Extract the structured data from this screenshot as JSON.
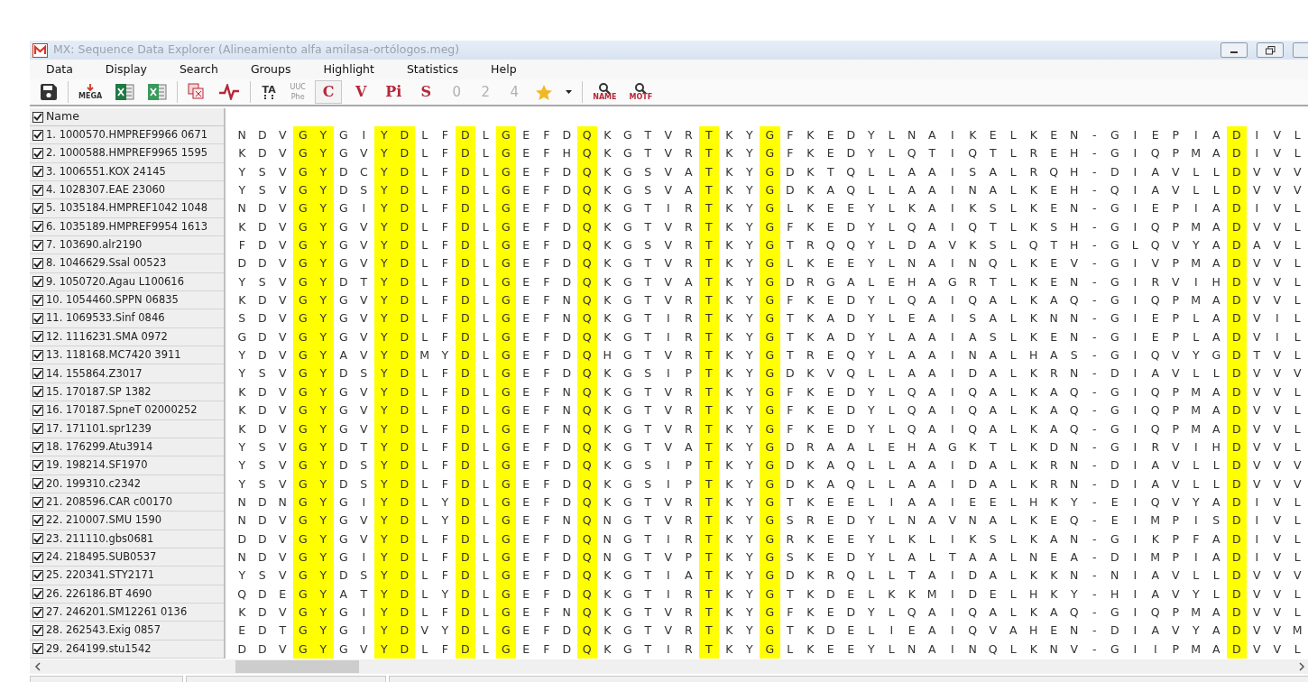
{
  "window": {
    "title": "MX: Sequence Data Explorer (Alineamiento alfa amilasa-ortólogos.meg)"
  },
  "menu": [
    "Data",
    "Display",
    "Search",
    "Groups",
    "Highlight",
    "Statistics",
    "Help"
  ],
  "toolbar": [
    {
      "kind": "save"
    },
    {
      "kind": "sep"
    },
    {
      "kind": "export",
      "label": "MEGA"
    },
    {
      "kind": "excel"
    },
    {
      "kind": "excel-alt"
    },
    {
      "kind": "sep"
    },
    {
      "kind": "copy"
    },
    {
      "kind": "plot"
    },
    {
      "kind": "sep"
    },
    {
      "kind": "translate",
      "label": "TA"
    },
    {
      "kind": "codon",
      "label": "UUC",
      "label2": "Phe",
      "disabled": true
    },
    {
      "kind": "toggle",
      "label": "C",
      "selected": true
    },
    {
      "kind": "toggle",
      "label": "V",
      "selected": false
    },
    {
      "kind": "toggle",
      "label": "Pi",
      "selected": false
    },
    {
      "kind": "toggle",
      "label": "S",
      "selected": false
    },
    {
      "kind": "digit",
      "label": "0",
      "disabled": true
    },
    {
      "kind": "digit",
      "label": "2",
      "disabled": true
    },
    {
      "kind": "digit",
      "label": "4",
      "disabled": true
    },
    {
      "kind": "star"
    },
    {
      "kind": "caret"
    },
    {
      "kind": "sep"
    },
    {
      "kind": "find",
      "label": "NAME"
    },
    {
      "kind": "find",
      "label": "MOTF"
    }
  ],
  "name_header": {
    "label": "Name",
    "checked": true
  },
  "columns": [
    {
      "highlighted": false
    },
    {
      "highlighted": false
    },
    {
      "highlighted": false
    },
    {
      "highlighted": true
    },
    {
      "highlighted": true
    },
    {
      "highlighted": false
    },
    {
      "highlighted": false
    },
    {
      "highlighted": true
    },
    {
      "highlighted": true
    },
    {
      "highlighted": false
    },
    {
      "highlighted": false
    },
    {
      "highlighted": true
    },
    {
      "highlighted": false
    },
    {
      "highlighted": true
    },
    {
      "highlighted": false
    },
    {
      "highlighted": false
    },
    {
      "highlighted": false
    },
    {
      "highlighted": true
    },
    {
      "highlighted": false
    },
    {
      "highlighted": false
    },
    {
      "highlighted": false
    },
    {
      "highlighted": false
    },
    {
      "highlighted": false
    },
    {
      "highlighted": true
    },
    {
      "highlighted": false
    },
    {
      "highlighted": false
    },
    {
      "highlighted": true
    },
    {
      "highlighted": false
    },
    {
      "highlighted": false
    },
    {
      "highlighted": false
    },
    {
      "highlighted": false
    },
    {
      "highlighted": false
    },
    {
      "highlighted": false
    },
    {
      "highlighted": false
    },
    {
      "highlighted": false
    },
    {
      "highlighted": false
    },
    {
      "highlighted": false
    },
    {
      "highlighted": false
    },
    {
      "highlighted": false
    },
    {
      "highlighted": false
    },
    {
      "highlighted": false
    },
    {
      "highlighted": false
    },
    {
      "highlighted": false
    },
    {
      "highlighted": false
    },
    {
      "highlighted": false
    },
    {
      "highlighted": false
    },
    {
      "highlighted": false
    },
    {
      "highlighted": false
    },
    {
      "highlighted": false
    },
    {
      "highlighted": true
    },
    {
      "highlighted": false
    },
    {
      "highlighted": false
    },
    {
      "highlighted": false
    }
  ],
  "sequences": [
    {
      "name": "1. 1000570.HMPREF9966 0671",
      "checked": true,
      "residues": "N D V G Y G I Y D L F D L G E F D Q K G T V R T K Y G F K E D Y L N A I K E L K E N - G I E P I A D I V L"
    },
    {
      "name": "2. 1000588.HMPREF9965 1595",
      "checked": true,
      "residues": "K D V G Y G V Y D L F D L G E F H Q K G T V R T K Y G F K E D Y L Q T I Q T L R E H - G I Q P M A D I V L"
    },
    {
      "name": "3. 1006551.KOX 24145",
      "checked": true,
      "residues": "Y S V G Y D C Y D L F D L G E F D Q K G S V A T K Y G D K T Q L L A A I S A L R Q H - D I A V L L D V V V"
    },
    {
      "name": "4. 1028307.EAE 23060",
      "checked": true,
      "residues": "Y S V G Y D S Y D L F D L G E F D Q K G S V A T K Y G D K A Q L L A A I N A L K E H - Q I A V L L D V V V"
    },
    {
      "name": "5. 1035184.HMPREF1042 1048",
      "checked": true,
      "residues": "N D V G Y G I Y D L F D L G E F D Q K G T I R T K Y G L K E E Y L K A I K S L K E N - G I E P I A D I V L"
    },
    {
      "name": "6. 1035189.HMPREF9954 1613",
      "checked": true,
      "residues": "K D V G Y G V Y D L F D L G E F D Q K G T V R T K Y G F K E D Y L Q A I Q T L K S H - G I Q P M A D V V L"
    },
    {
      "name": "7. 103690.alr2190",
      "checked": true,
      "residues": "F D V G Y G V Y D L F D L G E F D Q K G S V R T K Y G T R Q Q Y L D A V K S L Q T H - G L Q V Y A D A V L"
    },
    {
      "name": "8. 1046629.Ssal 00523",
      "checked": true,
      "residues": "D D V G Y G V Y D L F D L G E F D Q K G T V R T K Y G L K E E Y L N A I N Q L K E V - G I V P M A D V V L"
    },
    {
      "name": "9. 1050720.Agau L100616",
      "checked": true,
      "residues": "Y S V G Y D T Y D L F D L G E F D Q K G T V A T K Y G D R G A L E H A G R T L K E N - G I R V I H D V V L"
    },
    {
      "name": "10. 1054460.SPPN 06835",
      "checked": true,
      "residues": "K D V G Y G V Y D L F D L G E F N Q K G T V R T K Y G F K E D Y L Q A I Q A L K A Q - G I Q P M A D V V L"
    },
    {
      "name": "11. 1069533.Sinf 0846",
      "checked": true,
      "residues": "S D V G Y G V Y D L F D L G E F N Q K G T I R T K Y G T K A D Y L E A I S A L K N N - G I E P L A D V I L"
    },
    {
      "name": "12. 1116231.SMA 0972",
      "checked": true,
      "residues": "G D V G Y G V Y D L F D L G E F D Q K G T I R T K Y G T K A D Y L A A I A S L K E N - G I E P L A D V I L"
    },
    {
      "name": "13. 118168.MC7420 3911",
      "checked": true,
      "residues": "Y D V G Y A V Y D M Y D L G E F D Q H G T V R T K Y G T R E Q Y L A A I N A L H A S - G I Q V Y G D T V L"
    },
    {
      "name": "14. 155864.Z3017",
      "checked": true,
      "residues": "Y S V G Y D S Y D L F D L G E F D Q K G S I P T K Y G D K V Q L L A A I D A L K R N - D I A V L L D V V V"
    },
    {
      "name": "15. 170187.SP 1382",
      "checked": true,
      "residues": "K D V G Y G V Y D L F D L G E F N Q K G T V R T K Y G F K E D Y L Q A I Q A L K A Q - G I Q P M A D V V L"
    },
    {
      "name": "16. 170187.SpneT 02000252",
      "checked": true,
      "residues": "K D V G Y G V Y D L F D L G E F N Q K G T V R T K Y G F K E D Y L Q A I Q A L K A Q - G I Q P M A D V V L"
    },
    {
      "name": "17. 171101.spr1239",
      "checked": true,
      "residues": "K D V G Y G V Y D L F D L G E F N Q K G T V R T K Y G F K E D Y L Q A I Q A L K A Q - G I Q P M A D V V L"
    },
    {
      "name": "18. 176299.Atu3914",
      "checked": true,
      "residues": "Y S V G Y D T Y D L F D L G E F D Q K G T V A T K Y G D R A A L E H A G K T L K D N - G I R V I H D V V L"
    },
    {
      "name": "19. 198214.SF1970",
      "checked": true,
      "residues": "Y S V G Y D S Y D L F D L G E F D Q K G S I P T K Y G D K A Q L L A A I D A L K R N - D I A V L L D V V V"
    },
    {
      "name": "20. 199310.c2342",
      "checked": true,
      "residues": "Y S V G Y D S Y D L F D L G E F D Q K G S I P T K Y G D K A Q L L A A I D A L K R N - D I A V L L D V V V"
    },
    {
      "name": "21. 208596.CAR c00170",
      "checked": true,
      "residues": "N D N G Y G I Y D L Y D L G E F D Q K G T V R T K Y G T K E E L I A A I E E L H K Y - E I Q V Y A D I V L"
    },
    {
      "name": "22. 210007.SMU 1590",
      "checked": true,
      "residues": "N D V G Y G V Y D L Y D L G E F N Q N G T V R T K Y G S R E D Y L N A V N A L K E Q - E I M P I S D I V L"
    },
    {
      "name": "23. 211110.gbs0681",
      "checked": true,
      "residues": "D D V G Y G V Y D L F D L G E F D Q N G T I R T K Y G R K E E Y L K L I K S L K A N - G I K P F A D I V L"
    },
    {
      "name": "24. 218495.SUB0537",
      "checked": true,
      "residues": "N D V G Y G I Y D L F D L G E F D Q N G T V P T K Y G S K E D Y L A L T A A L N E A - D I M P I A D I V L"
    },
    {
      "name": "25. 220341.STY2171",
      "checked": true,
      "residues": "Y S V G Y D S Y D L F D L G E F D Q K G T I A T K Y G D K R Q L L T A I D A L K K N - N I A V L L D V V V"
    },
    {
      "name": "26. 226186.BT 4690",
      "checked": true,
      "residues": "Q D E G Y A T Y D L Y D L G E F D Q K G T I R T K Y G T K D E L K K M I D E L H K Y - H I A V Y L D V V L"
    },
    {
      "name": "27. 246201.SM12261 0136",
      "checked": true,
      "residues": "K D V G Y G I Y D L F D L G E F N Q K G T V R T K Y G F K E D Y L Q A I Q A L K A Q - G I Q P M A D V V L"
    },
    {
      "name": "28. 262543.Exig 0857",
      "checked": true,
      "residues": "E D T G Y G I Y D V Y D L G E F D Q K G T V R T K Y G T K D E L I E A I Q V A H E N - D I A V Y A D V V M"
    },
    {
      "name": "29. 264199.stu1542",
      "checked": true,
      "residues": "D D V G Y G V Y D L F D L G E F D Q K G T I R T K Y G L K E E Y L N A I N Q L K N V - G I I P M A D V V L"
    }
  ]
}
